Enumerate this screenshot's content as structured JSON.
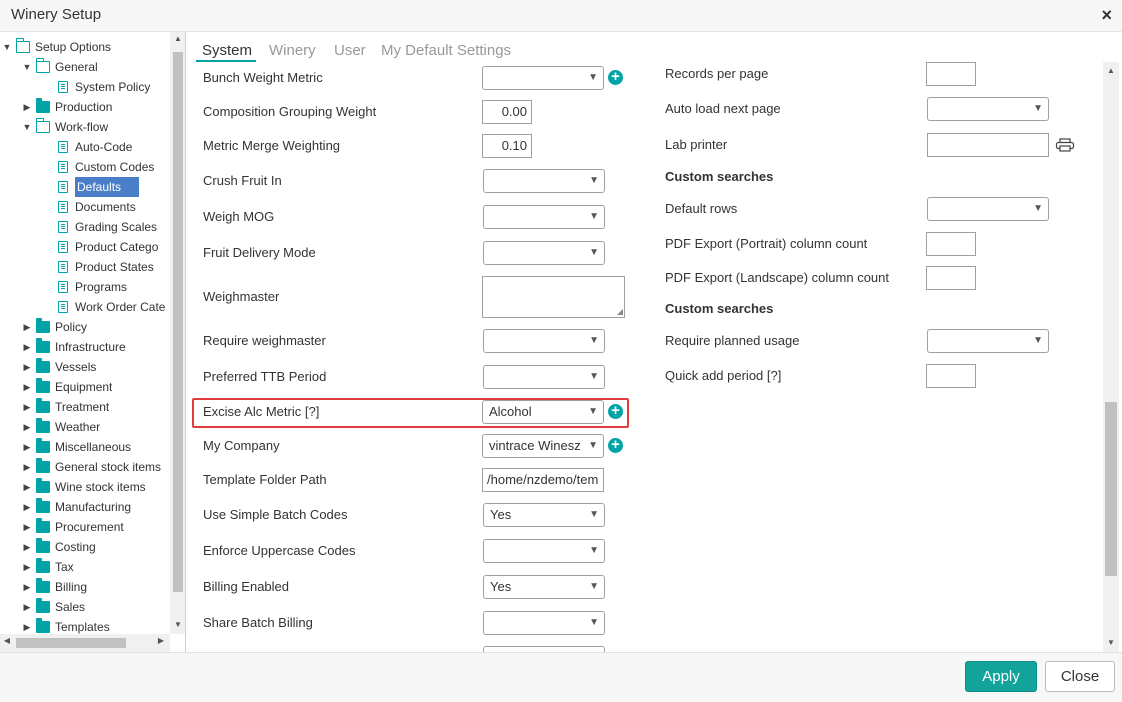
{
  "window": {
    "title": "Winery Setup"
  },
  "tree": {
    "items": [
      {
        "label": "Setup Options",
        "icon": "folder-open",
        "arrow": "down",
        "level": 0
      },
      {
        "label": "General",
        "icon": "folder-open",
        "arrow": "down",
        "level": 1
      },
      {
        "label": "System Policy",
        "icon": "document",
        "arrow": "",
        "level": 2
      },
      {
        "label": "Production",
        "icon": "folder-closed",
        "arrow": "right",
        "level": 1
      },
      {
        "label": "Work-flow",
        "icon": "folder-open",
        "arrow": "down",
        "level": 1
      },
      {
        "label": "Auto-Code",
        "icon": "document",
        "arrow": "",
        "level": 2
      },
      {
        "label": "Custom Codes",
        "icon": "document",
        "arrow": "",
        "level": 2
      },
      {
        "label": "Defaults",
        "icon": "document",
        "arrow": "",
        "level": 2,
        "selected": true
      },
      {
        "label": "Documents",
        "icon": "document",
        "arrow": "",
        "level": 2
      },
      {
        "label": "Grading Scales",
        "icon": "document",
        "arrow": "",
        "level": 2
      },
      {
        "label": "Product Catego",
        "icon": "document",
        "arrow": "",
        "level": 2
      },
      {
        "label": "Product States",
        "icon": "document",
        "arrow": "",
        "level": 2
      },
      {
        "label": "Programs",
        "icon": "document",
        "arrow": "",
        "level": 2
      },
      {
        "label": "Work Order Cate",
        "icon": "document",
        "arrow": "",
        "level": 2
      },
      {
        "label": "Policy",
        "icon": "folder-closed",
        "arrow": "right",
        "level": 1
      },
      {
        "label": "Infrastructure",
        "icon": "folder-closed",
        "arrow": "right",
        "level": 1
      },
      {
        "label": "Vessels",
        "icon": "folder-closed",
        "arrow": "right",
        "level": 1
      },
      {
        "label": "Equipment",
        "icon": "folder-closed",
        "arrow": "right",
        "level": 1
      },
      {
        "label": "Treatment",
        "icon": "folder-closed",
        "arrow": "right",
        "level": 1
      },
      {
        "label": "Weather",
        "icon": "folder-closed",
        "arrow": "right",
        "level": 1
      },
      {
        "label": "Miscellaneous",
        "icon": "folder-closed",
        "arrow": "right",
        "level": 1
      },
      {
        "label": "General stock items",
        "icon": "folder-closed",
        "arrow": "right",
        "level": 1
      },
      {
        "label": "Wine stock items",
        "icon": "folder-closed",
        "arrow": "right",
        "level": 1
      },
      {
        "label": "Manufacturing",
        "icon": "folder-closed",
        "arrow": "right",
        "level": 1
      },
      {
        "label": "Procurement",
        "icon": "folder-closed",
        "arrow": "right",
        "level": 1
      },
      {
        "label": "Costing",
        "icon": "folder-closed",
        "arrow": "right",
        "level": 1
      },
      {
        "label": "Tax",
        "icon": "folder-closed",
        "arrow": "right",
        "level": 1
      },
      {
        "label": "Billing",
        "icon": "folder-closed",
        "arrow": "right",
        "level": 1
      },
      {
        "label": "Sales",
        "icon": "folder-closed",
        "arrow": "right",
        "level": 1
      },
      {
        "label": "Templates",
        "icon": "folder-closed",
        "arrow": "right",
        "level": 1
      }
    ]
  },
  "tabs": [
    {
      "label": "System",
      "active": true
    },
    {
      "label": "Winery",
      "active": false
    },
    {
      "label": "User",
      "active": false
    },
    {
      "label": "My Default Settings",
      "active": false
    }
  ],
  "left_form": {
    "bunch_weight_metric": {
      "label": "Bunch Weight Metric",
      "value": ""
    },
    "composition_grouping_weight": {
      "label": "Composition Grouping Weight",
      "value": "0.00"
    },
    "metric_merge_weighting": {
      "label": "Metric Merge Weighting",
      "value": "0.10"
    },
    "crush_fruit_in": {
      "label": "Crush Fruit In",
      "value": ""
    },
    "weigh_mog": {
      "label": "Weigh MOG",
      "value": ""
    },
    "fruit_delivery_mode": {
      "label": "Fruit Delivery Mode",
      "value": ""
    },
    "weighmaster": {
      "label": "Weighmaster",
      "value": ""
    },
    "require_weighmaster": {
      "label": "Require weighmaster",
      "value": ""
    },
    "preferred_ttb_period": {
      "label": "Preferred TTB Period",
      "value": ""
    },
    "excise_alc_metric": {
      "label": "Excise Alc Metric [?]",
      "value": "Alcohol"
    },
    "my_company": {
      "label": "My Company",
      "value": "vintrace Winesz"
    },
    "template_folder_path": {
      "label": "Template Folder Path",
      "value": "/home/nzdemo/tem"
    },
    "use_simple_batch_codes": {
      "label": "Use Simple Batch Codes",
      "value": "Yes"
    },
    "enforce_uppercase_codes": {
      "label": "Enforce Uppercase Codes",
      "value": ""
    },
    "billing_enabled": {
      "label": "Billing Enabled",
      "value": "Yes"
    },
    "share_batch_billing": {
      "label": "Share Batch Billing",
      "value": ""
    }
  },
  "right_form": {
    "records_per_page": {
      "label": "Records per page",
      "value": ""
    },
    "auto_load_next_page": {
      "label": "Auto load next page",
      "value": ""
    },
    "lab_printer": {
      "label": "Lab printer",
      "value": ""
    },
    "custom_searches_1": "Custom searches",
    "default_rows": {
      "label": "Default rows",
      "value": ""
    },
    "pdf_export_portrait": {
      "label": "PDF Export (Portrait) column count",
      "value": ""
    },
    "pdf_export_landscape": {
      "label": "PDF Export (Landscape) column count",
      "value": ""
    },
    "custom_searches_2": "Custom searches",
    "require_planned_usage": {
      "label": "Require planned usage",
      "value": ""
    },
    "quick_add_period": {
      "label": "Quick add period [?]",
      "value": ""
    }
  },
  "footer": {
    "apply_label": "Apply",
    "close_label": "Close"
  },
  "colors": {
    "accent": "#00a4a6",
    "highlight": "#e03e3e",
    "selected": "#4a7ec9",
    "apply_button": "#12a39a"
  }
}
